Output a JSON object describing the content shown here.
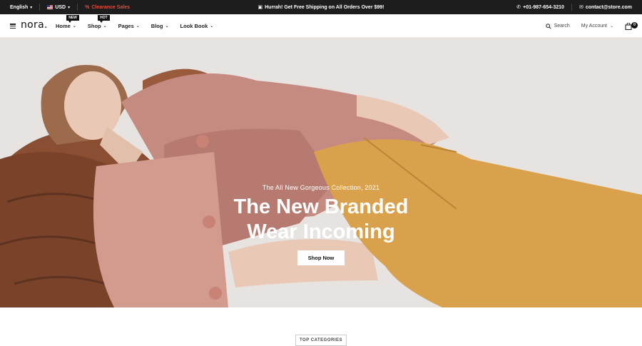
{
  "topbar": {
    "language": "English",
    "currency": "USD",
    "clearance": "Clearance Sales",
    "promo": "Hurrah! Get Free Shipping on All Orders Over $99!",
    "phone": "+01-987-654-3210",
    "email": "contact@store.com"
  },
  "header": {
    "logo": "nora.",
    "nav": [
      {
        "label": "Home",
        "badge": "NEW"
      },
      {
        "label": "Shop",
        "badge": "HOT"
      },
      {
        "label": "Pages",
        "badge": ""
      },
      {
        "label": "Blog",
        "badge": ""
      },
      {
        "label": "Look Book",
        "badge": ""
      }
    ],
    "search_label": "Search",
    "account_label": "My Account",
    "cart_count": "0"
  },
  "hero": {
    "subtitle": "The All New Gorgeous Collection, 2021",
    "title_line1": "The New Branded",
    "title_line2": "Wear Incoming",
    "button_label": "Shop Now"
  },
  "section": {
    "top_categories_label": "TOP CATEGORIES"
  },
  "colors": {
    "topbar_bg": "#1d1d1d",
    "clearance": "#e74c3c",
    "hero_bg": "#e7e3e1"
  }
}
